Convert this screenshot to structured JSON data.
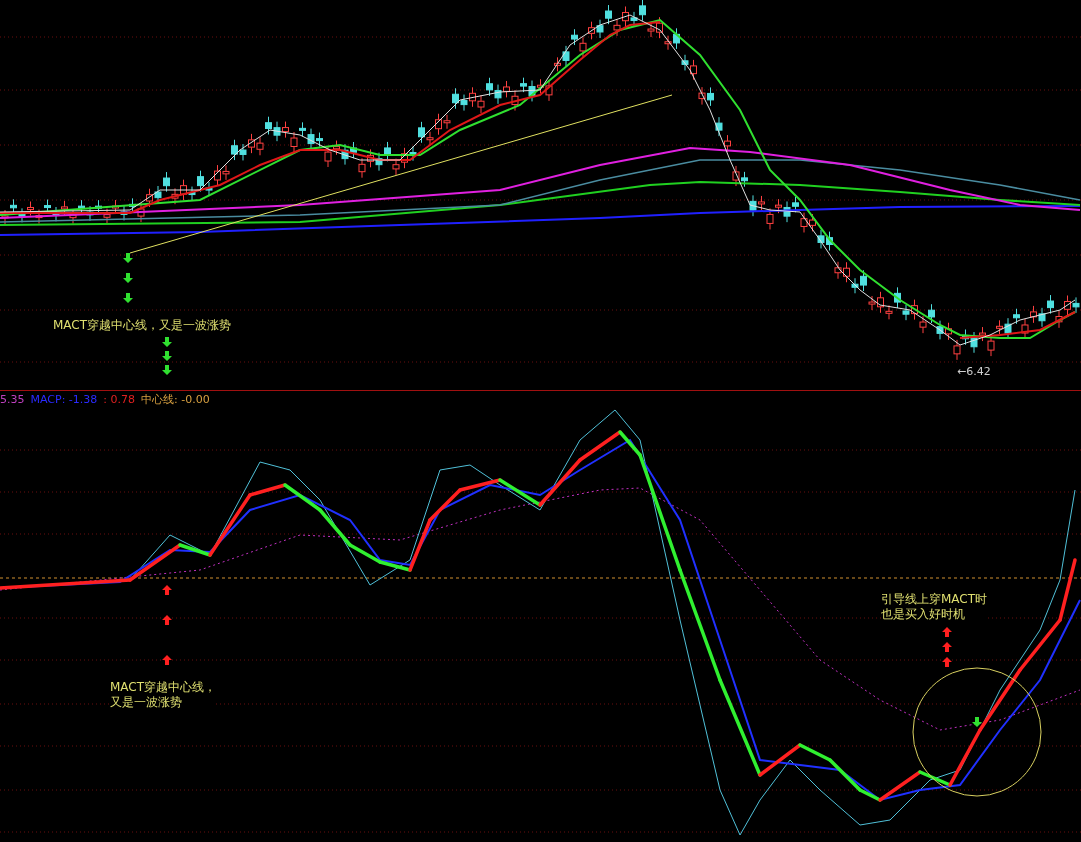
{
  "price_panel": {
    "annotations": [
      {
        "lines": [
          "MACT穿越中心线，又是一波涨势"
        ]
      }
    ],
    "low_marker": "←6.42"
  },
  "indicator_panel": {
    "legend": [
      {
        "text": "5.35",
        "color": "#c040c0"
      },
      {
        "text": "MACP: -1.38",
        "color": "#2a2aff"
      },
      {
        "text": ": 0.78",
        "color": "#e02020"
      },
      {
        "text": "中心线: -0.00",
        "color": "#d8a040"
      }
    ],
    "annotations": [
      {
        "lines": [
          "MACT穿越中心线，",
          "又是一波涨势"
        ]
      },
      {
        "lines": [
          "引导线上穿MACT时",
          "也是买入好时机"
        ]
      }
    ]
  }
}
